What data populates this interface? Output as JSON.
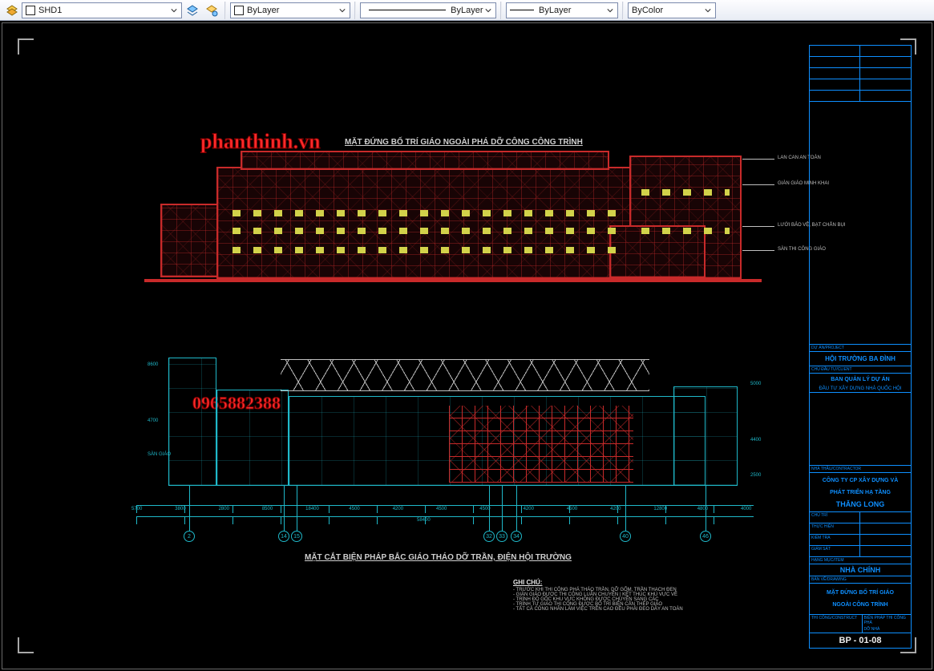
{
  "toolbar": {
    "layer_dropdown": "SHD1",
    "layer_color_swatch": "#ffffff",
    "color_dropdown": "ByLayer",
    "linetype_dropdown": "ByLayer",
    "lineweight_dropdown": "ByLayer",
    "plotstyle_dropdown": "ByColor"
  },
  "watermarks": {
    "url": "phanthinh.vn",
    "phone": "0965882388"
  },
  "drawing": {
    "elevation_title": "MẶT ĐỨNG BỐ TRÍ GIÁO NGOÀI PHÁ DỠ CÔNG CÔNG TRÌNH",
    "section_title": "MẶT CẮT BIỆN PHÁP BẮC GIÁO THÁO DỠ TRẦN, ĐIỆN HỘI TRƯỜNG",
    "callouts": {
      "c1": "LAN CAN AN TOÀN",
      "c2": "GIÀN GIÁO MINH KHAI",
      "c3": "LƯỚI BẢO VỆ, BẠT CHẮN BỤI",
      "c4": "SÀN THI CÔNG GIÁO"
    },
    "dimensions_bottom": [
      "5700",
      "3800",
      "2800",
      "8500",
      "18400",
      "4500",
      "4200",
      "4500",
      "4500",
      "4200",
      "4500",
      "4200",
      "12800",
      "4800",
      "4000"
    ],
    "dimensions_span": [
      "58400"
    ],
    "grid_labels": [
      "2",
      "14",
      "15",
      "32",
      "33",
      "34",
      "40",
      "46"
    ],
    "levels_left": [
      "8600",
      "4700",
      "SÀN GIÁO"
    ],
    "levels_right": [
      "5000",
      "4400",
      "2500"
    ]
  },
  "notes": {
    "title": "GHI CHÚ:",
    "lines": [
      "- TRƯỚC KHI THI CÔNG PHÁ THÁO TRẦN, DỠ GỐM, TRẦN THẠCH ĐEN",
      "- GIÀN GIÁO ĐƯỢC THI CÔNG LUÂN CHUYỂN | KẾT THÚC KHU VỰC VỀ",
      "- TRÌNH ĐỘ GỐC KHU VỰC KHÔNG ĐƯỢC CHUYỂN SANG CÁC",
      "- TRÌNH TỰ GIÁO THI CÔNG ĐƯỢC BỐ TRÍ BIỆN CẤN THÉP GIÁO",
      "- TẤT CẢ CÔNG NHÂN LÀM VIỆC TRÊN CAO ĐỀU PHẢI ĐEO DÂY AN TOÀN"
    ]
  },
  "titleblock": {
    "project_label": "DỰ ÁN/PROJECT",
    "project_name": "HỘI TRƯỜNG BA ĐÌNH",
    "client_label": "CHỦ ĐẦU TƯ/CLIENT",
    "client_name_1": "BAN QUẢN LÝ DỰ ÁN",
    "client_name_2": "ĐẦU TƯ XÂY DỰNG NHÀ QUỐC HỘI",
    "contractor_label": "NHÀ THẦU/CONTRACTOR",
    "contractor_1": "CÔNG TY CP XÂY DỰNG VÀ",
    "contractor_2": "PHÁT TRIỂN HẠ TẦNG",
    "contractor_3": "THĂNG LONG",
    "building_label": "HẠNG MỤC/ITEM",
    "building_name": "NHÀ CHÍNH",
    "drawing_label": "BẢN VẼ/DRAWING",
    "drawing_title_1": "MẶT ĐỨNG BỐ TRÍ GIÁO",
    "drawing_title_2": "NGOÀI CÔNG TRÌNH",
    "stage_right_1": "BIỆN PHÁP THI CÔNG PHÁ",
    "stage_right_2": "DỠ NHÀ",
    "sheet_label_left": "THI CÔNG/CONSTRUCT",
    "sheet_no": "BP - 01-08",
    "small_cells": [
      "CHỦ TRÌ",
      "",
      "THỰC HIỆN",
      "",
      "KIỂM TRA",
      "",
      "GIÁM SÁT",
      ""
    ]
  }
}
